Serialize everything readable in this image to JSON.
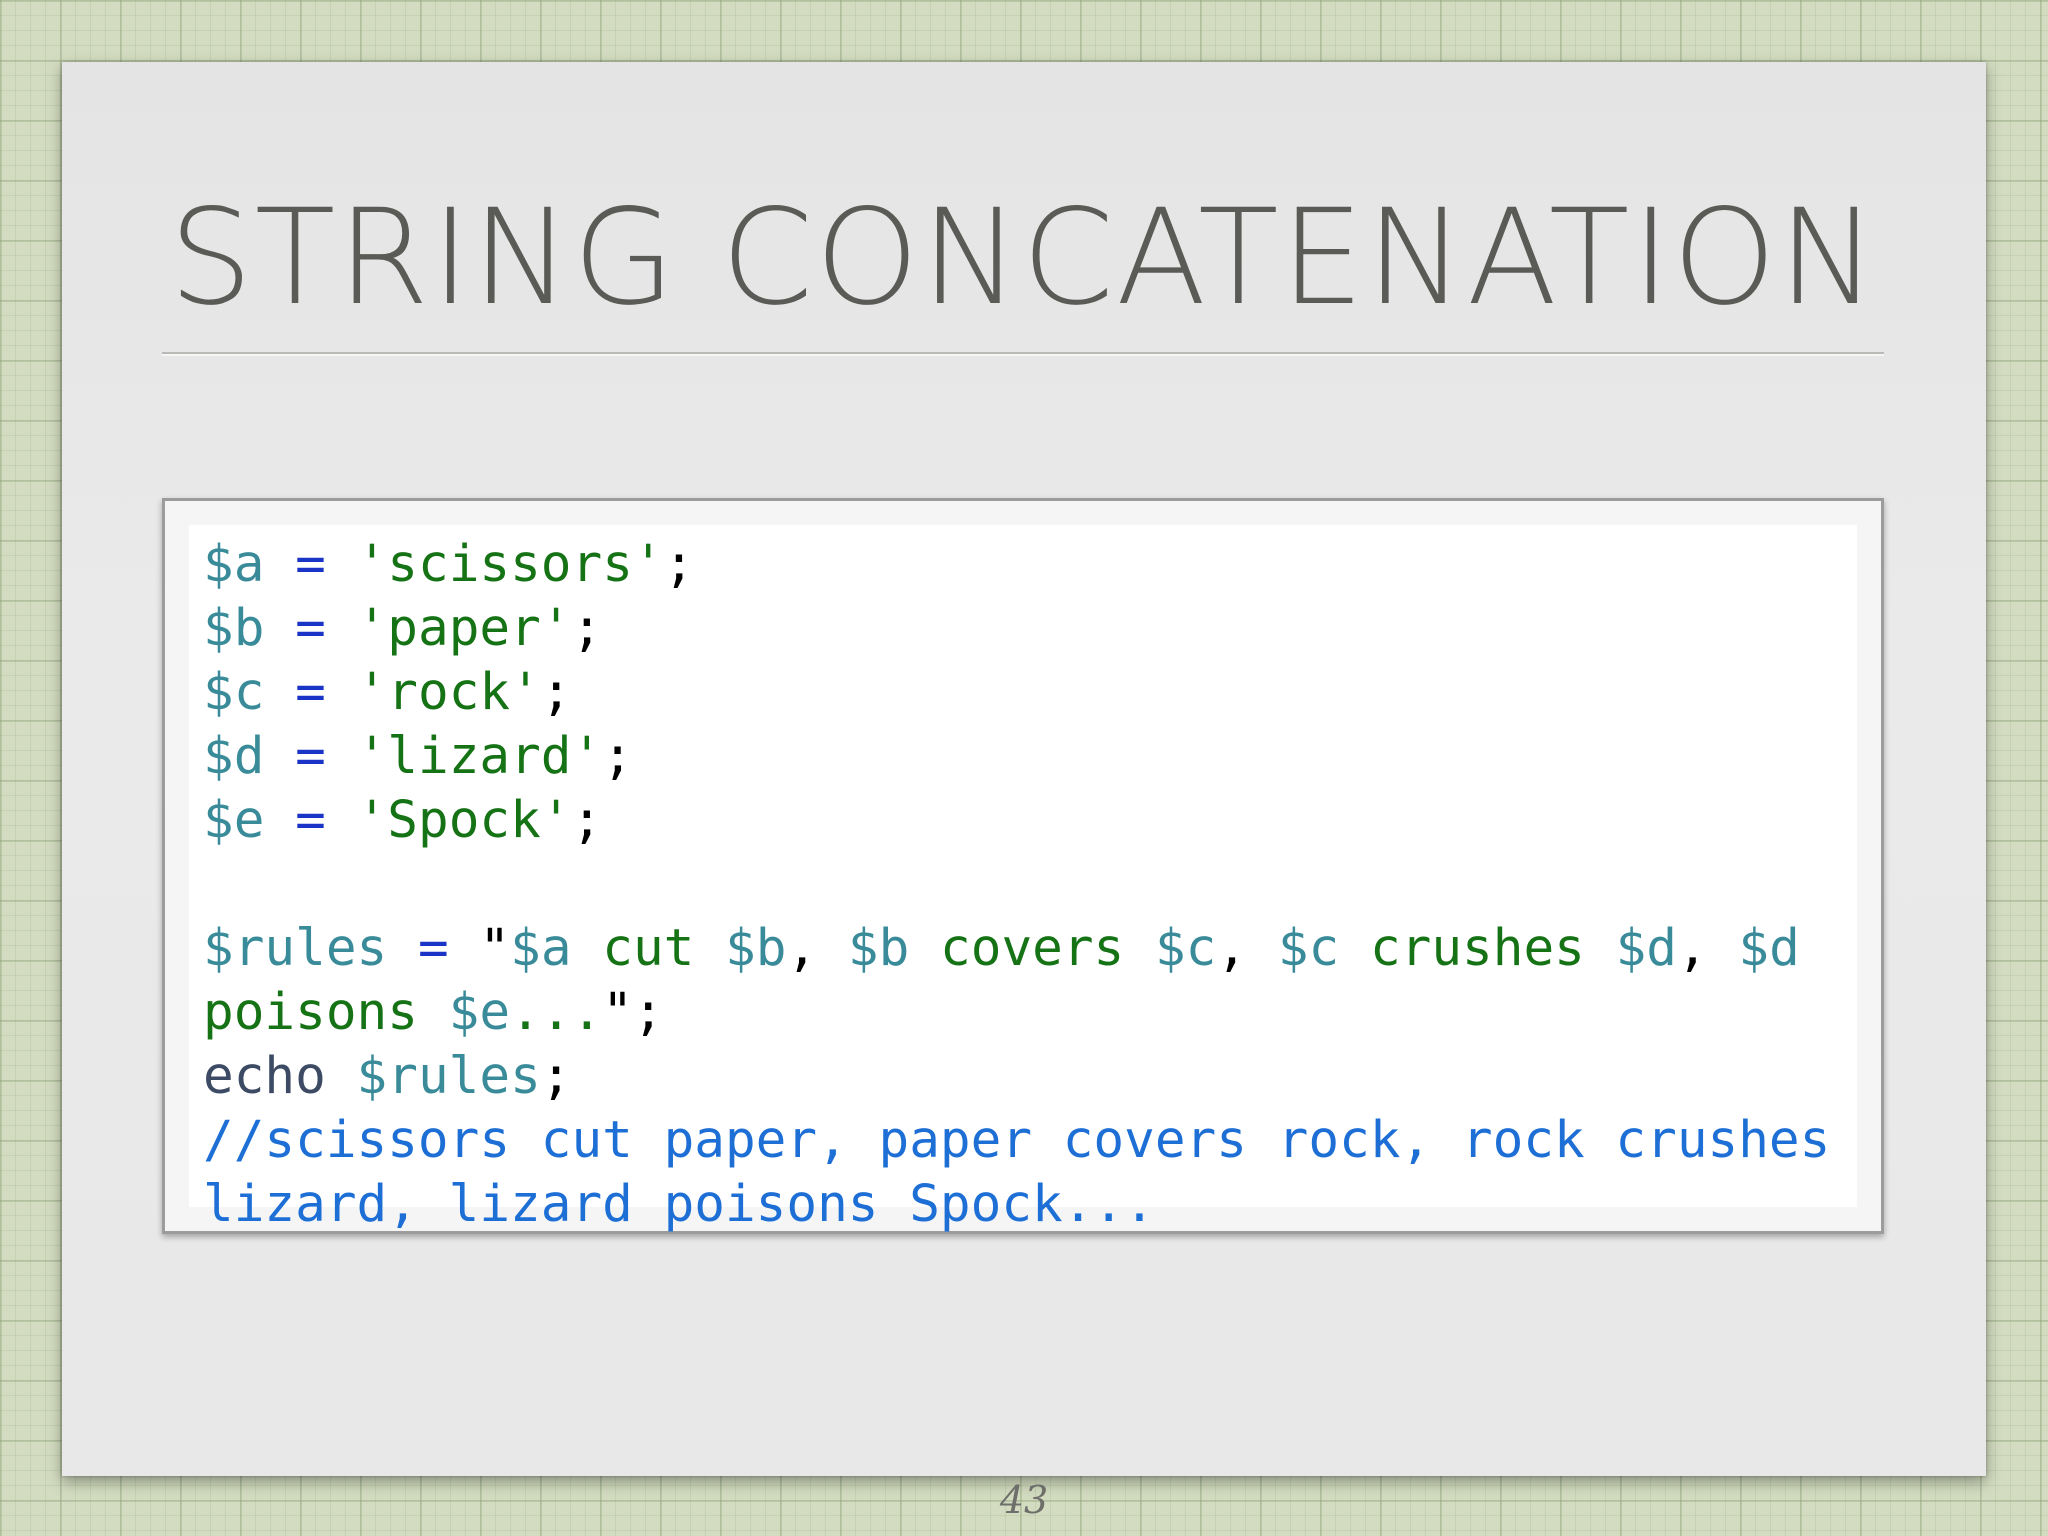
{
  "slide": {
    "title": "STRING CONCATENATION",
    "page_number": "43"
  },
  "colors": {
    "background": "#d3dcc0",
    "slide": "#e6e6e6",
    "title": "#5a5a56",
    "variable": "#3a8b9a",
    "operator": "#1a34c8",
    "string": "#157315",
    "comment": "#1d6fd6"
  },
  "code": {
    "lines": [
      [
        {
          "t": "$a",
          "k": "var"
        },
        {
          "t": " ",
          "k": "plain"
        },
        {
          "t": "=",
          "k": "op"
        },
        {
          "t": " ",
          "k": "plain"
        },
        {
          "t": "'scissors'",
          "k": "str"
        },
        {
          "t": ";",
          "k": "plain"
        }
      ],
      [
        {
          "t": "$b",
          "k": "var"
        },
        {
          "t": " ",
          "k": "plain"
        },
        {
          "t": "=",
          "k": "op"
        },
        {
          "t": " ",
          "k": "plain"
        },
        {
          "t": "'paper'",
          "k": "str"
        },
        {
          "t": ";",
          "k": "plain"
        }
      ],
      [
        {
          "t": "$c",
          "k": "var"
        },
        {
          "t": " ",
          "k": "plain"
        },
        {
          "t": "=",
          "k": "op"
        },
        {
          "t": " ",
          "k": "plain"
        },
        {
          "t": "'rock'",
          "k": "str"
        },
        {
          "t": ";",
          "k": "plain"
        }
      ],
      [
        {
          "t": "$d",
          "k": "var"
        },
        {
          "t": " ",
          "k": "plain"
        },
        {
          "t": "=",
          "k": "op"
        },
        {
          "t": " ",
          "k": "plain"
        },
        {
          "t": "'lizard'",
          "k": "str"
        },
        {
          "t": ";",
          "k": "plain"
        }
      ],
      [
        {
          "t": "$e",
          "k": "var"
        },
        {
          "t": " ",
          "k": "plain"
        },
        {
          "t": "=",
          "k": "op"
        },
        {
          "t": " ",
          "k": "plain"
        },
        {
          "t": "'Spock'",
          "k": "str"
        },
        {
          "t": ";",
          "k": "plain"
        }
      ],
      [],
      [
        {
          "t": "$rules",
          "k": "var"
        },
        {
          "t": " ",
          "k": "plain"
        },
        {
          "t": "=",
          "k": "op"
        },
        {
          "t": " ",
          "k": "plain"
        },
        {
          "t": "\"",
          "k": "plain"
        },
        {
          "t": "$a",
          "k": "var"
        },
        {
          "t": " cut ",
          "k": "str"
        },
        {
          "t": "$b",
          "k": "var"
        },
        {
          "t": ", ",
          "k": "plain"
        },
        {
          "t": "$b",
          "k": "var"
        },
        {
          "t": " covers ",
          "k": "str"
        },
        {
          "t": "$c",
          "k": "var"
        },
        {
          "t": ", ",
          "k": "plain"
        },
        {
          "t": "$c",
          "k": "var"
        },
        {
          "t": " crushes ",
          "k": "str"
        },
        {
          "t": "$d",
          "k": "var"
        },
        {
          "t": ", ",
          "k": "plain"
        },
        {
          "t": "$d",
          "k": "var"
        }
      ],
      [
        {
          "t": "poisons ",
          "k": "str"
        },
        {
          "t": "$e",
          "k": "var"
        },
        {
          "t": "...",
          "k": "str"
        },
        {
          "t": "\";",
          "k": "plain"
        }
      ],
      [
        {
          "t": "echo",
          "k": "fn"
        },
        {
          "t": " ",
          "k": "plain"
        },
        {
          "t": "$rules",
          "k": "var"
        },
        {
          "t": ";",
          "k": "plain"
        }
      ],
      [
        {
          "t": "//scissors cut paper, paper covers rock, rock crushes",
          "k": "cmt"
        }
      ],
      [
        {
          "t": "lizard, lizard poisons Spock...",
          "k": "cmt"
        }
      ]
    ]
  }
}
